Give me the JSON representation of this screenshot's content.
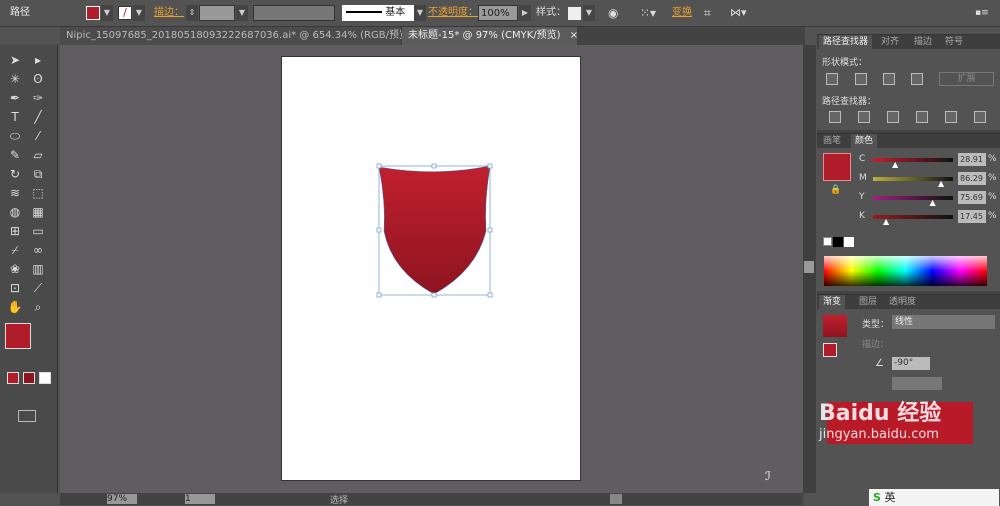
{
  "control_bar": {
    "object_type": "路径",
    "stroke_label": "描边：",
    "stroke_style": "基本",
    "opacity_label": "不透明度：",
    "opacity": "100%",
    "style_label": "样式：",
    "recolor_label": "变换"
  },
  "colors": {
    "fill": "#b01c2a",
    "shield_top": "#c1202e",
    "shield_bottom": "#8e1420",
    "accent": "#e8a030"
  },
  "doc_tabs": [
    {
      "label": "Nipic_15097685_20180518093222687036.ai* @ 654.34% (RGB/预览)",
      "close": "×"
    },
    {
      "label": "未标题-15* @ 97% (CMYK/预览)",
      "close": "×",
      "active": true
    }
  ],
  "tools": [
    "selection-icon",
    "direct-selection-icon",
    "magic-wand-icon",
    "lasso-icon",
    "pen-icon",
    "curvature-icon",
    "type-icon",
    "line-icon",
    "ellipse-icon",
    "paintbrush-icon",
    "pencil-icon",
    "eraser-icon",
    "rotate-icon",
    "scale-icon",
    "warp-icon",
    "free-transform-icon",
    "shape-builder-icon",
    "perspective-icon",
    "mesh-icon",
    "gradient-icon",
    "eyedropper-icon",
    "blend-icon",
    "symbol-sprayer-icon",
    "graph-icon",
    "artboard-icon",
    "slice-icon",
    "hand-icon",
    "zoom-icon"
  ],
  "pathfinder": {
    "tabs": [
      "路径查找器",
      "对齐",
      "描边",
      "符号"
    ],
    "shape_modes": "形状模式：",
    "expand": "扩展",
    "pathfinders": "路径查找器："
  },
  "color_panel": {
    "tabs": [
      "画笔",
      "颜色"
    ],
    "channels": [
      {
        "name": "C",
        "value": "28.91",
        "pct": 28.91,
        "color": "#c02030"
      },
      {
        "name": "M",
        "value": "86.29",
        "pct": 86.29,
        "color": "#b8b040"
      },
      {
        "name": "Y",
        "value": "75.69",
        "pct": 75.69,
        "color": "#a02080"
      },
      {
        "name": "K",
        "value": "17.45",
        "pct": 17.45,
        "color": "#902020"
      }
    ],
    "percent": "%"
  },
  "gradient_panel": {
    "tabs": [
      "渐变",
      "图层",
      "透明度"
    ],
    "type_label": "类型：",
    "type_value": "线性",
    "stroke_label": "描边：",
    "angle": "-90°"
  },
  "status": {
    "zoom": "97%",
    "page": "1",
    "tool": "选择"
  },
  "watermark": {
    "text": "Baidu 经验",
    "url": "jingyan.baidu.com"
  },
  "taskbar": {
    "ime": "英"
  }
}
